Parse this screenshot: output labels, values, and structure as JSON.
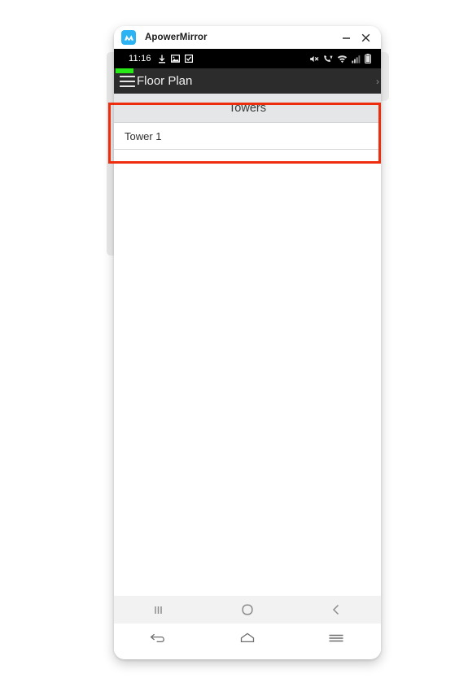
{
  "window": {
    "app_title": "ApowerMirror",
    "logo_icon": "apowermirror-logo-icon",
    "minimize_label": "−",
    "close_label": "×",
    "minimize_icon": "minimize-icon",
    "close_icon": "close-icon",
    "accent_color": "#2bb3f3"
  },
  "status_bar": {
    "time": "11:16",
    "left_icons": [
      "download-icon",
      "image-icon",
      "checkbox-icon"
    ],
    "right_icons": [
      "mute-icon",
      "volte-call-icon",
      "wifi-icon",
      "signal-bars-icon",
      "battery-icon"
    ],
    "background_color": "#000000"
  },
  "app_bar": {
    "menu_icon": "hamburger-menu-icon",
    "title": "Floor Plan",
    "chevron": "›",
    "chevron_icon": "chevron-right-icon",
    "background_color": "#2c2c2c",
    "indicator_color": "#28e818"
  },
  "content": {
    "section_header": "Towers",
    "rows": [
      {
        "label": "Tower 1"
      }
    ]
  },
  "android_nav": {
    "items": [
      {
        "icon": "recents-icon",
        "label": "Recents"
      },
      {
        "icon": "home-circle-icon",
        "label": "Home"
      },
      {
        "icon": "back-chevron-icon",
        "label": "Back"
      }
    ]
  },
  "mirror_controls": {
    "items": [
      {
        "icon": "back-arrow-icon",
        "label": "Back"
      },
      {
        "icon": "home-house-icon",
        "label": "Home"
      },
      {
        "icon": "menu-lines-icon",
        "label": "Menu"
      }
    ]
  },
  "annotation": {
    "color": "#ee2d0f",
    "shape": "rectangle-highlight"
  }
}
